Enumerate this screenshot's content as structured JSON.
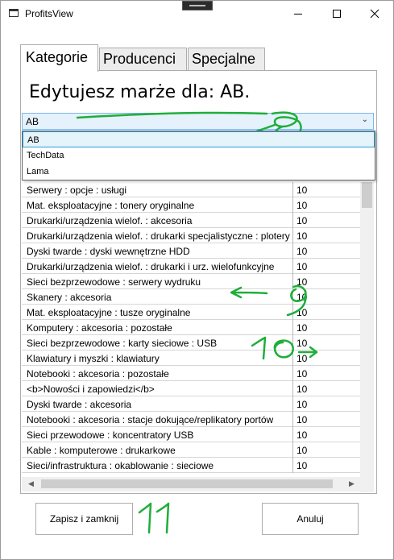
{
  "window": {
    "title": "ProfitsView"
  },
  "tabs": [
    {
      "label": "Kategorie",
      "active": true
    },
    {
      "label": "Producenci",
      "active": false
    },
    {
      "label": "Specjalne",
      "active": false
    }
  ],
  "heading": "Edytujesz marże dla: AB.",
  "combo": {
    "value": "AB",
    "options": [
      "AB",
      "TechData",
      "Lama"
    ],
    "selected_option": "AB"
  },
  "grid": {
    "rows": [
      {
        "name": "Serwery : opcje : usługi",
        "value": "10"
      },
      {
        "name": "Mat. eksploatacyjne : tonery oryginalne",
        "value": "10"
      },
      {
        "name": "Drukarki/urządzenia wielof. : akcesoria",
        "value": "10"
      },
      {
        "name": "Drukarki/urządzenia wielof. : drukarki specjalistyczne : plotery",
        "value": "10"
      },
      {
        "name": "Dyski twarde : dyski wewnętrzne HDD",
        "value": "10"
      },
      {
        "name": "Drukarki/urządzenia wielof. : drukarki i urz. wielofunkcyjne",
        "value": "10"
      },
      {
        "name": "Sieci bezprzewodowe : serwery wydruku",
        "value": "10"
      },
      {
        "name": "Skanery : akcesoria",
        "value": "10"
      },
      {
        "name": "Mat. eksploatacyjne : tusze oryginalne",
        "value": "10"
      },
      {
        "name": "Komputery : akcesoria : pozostałe",
        "value": "10"
      },
      {
        "name": "Sieci bezprzewodowe : karty sieciowe : USB",
        "value": "10"
      },
      {
        "name": "Klawiatury i myszki : klawiatury",
        "value": "10"
      },
      {
        "name": "Notebooki : akcesoria : pozostałe",
        "value": "10"
      },
      {
        "name": "<b>Nowości i zapowiedzi</b>",
        "value": "10"
      },
      {
        "name": "Dyski twarde : akcesoria",
        "value": "10"
      },
      {
        "name": "Notebooki : akcesoria : stacje dokujące/replikatory portów",
        "value": "10"
      },
      {
        "name": "Sieci przewodowe : koncentratory USB",
        "value": "10"
      },
      {
        "name": "Kable : komputerowe : drukarkowe",
        "value": "10"
      },
      {
        "name": "Sieci/infrastruktura : okablowanie : sieciowe",
        "value": "10"
      }
    ]
  },
  "buttons": {
    "save": "Zapisz i zamknij",
    "cancel": "Anuluj"
  },
  "annotations": [
    "8",
    "9",
    "10",
    "11"
  ],
  "colors": {
    "annotation": "#1fae3a",
    "selection_border": "#26a0da",
    "combo_bg": "#e5f1fb"
  }
}
